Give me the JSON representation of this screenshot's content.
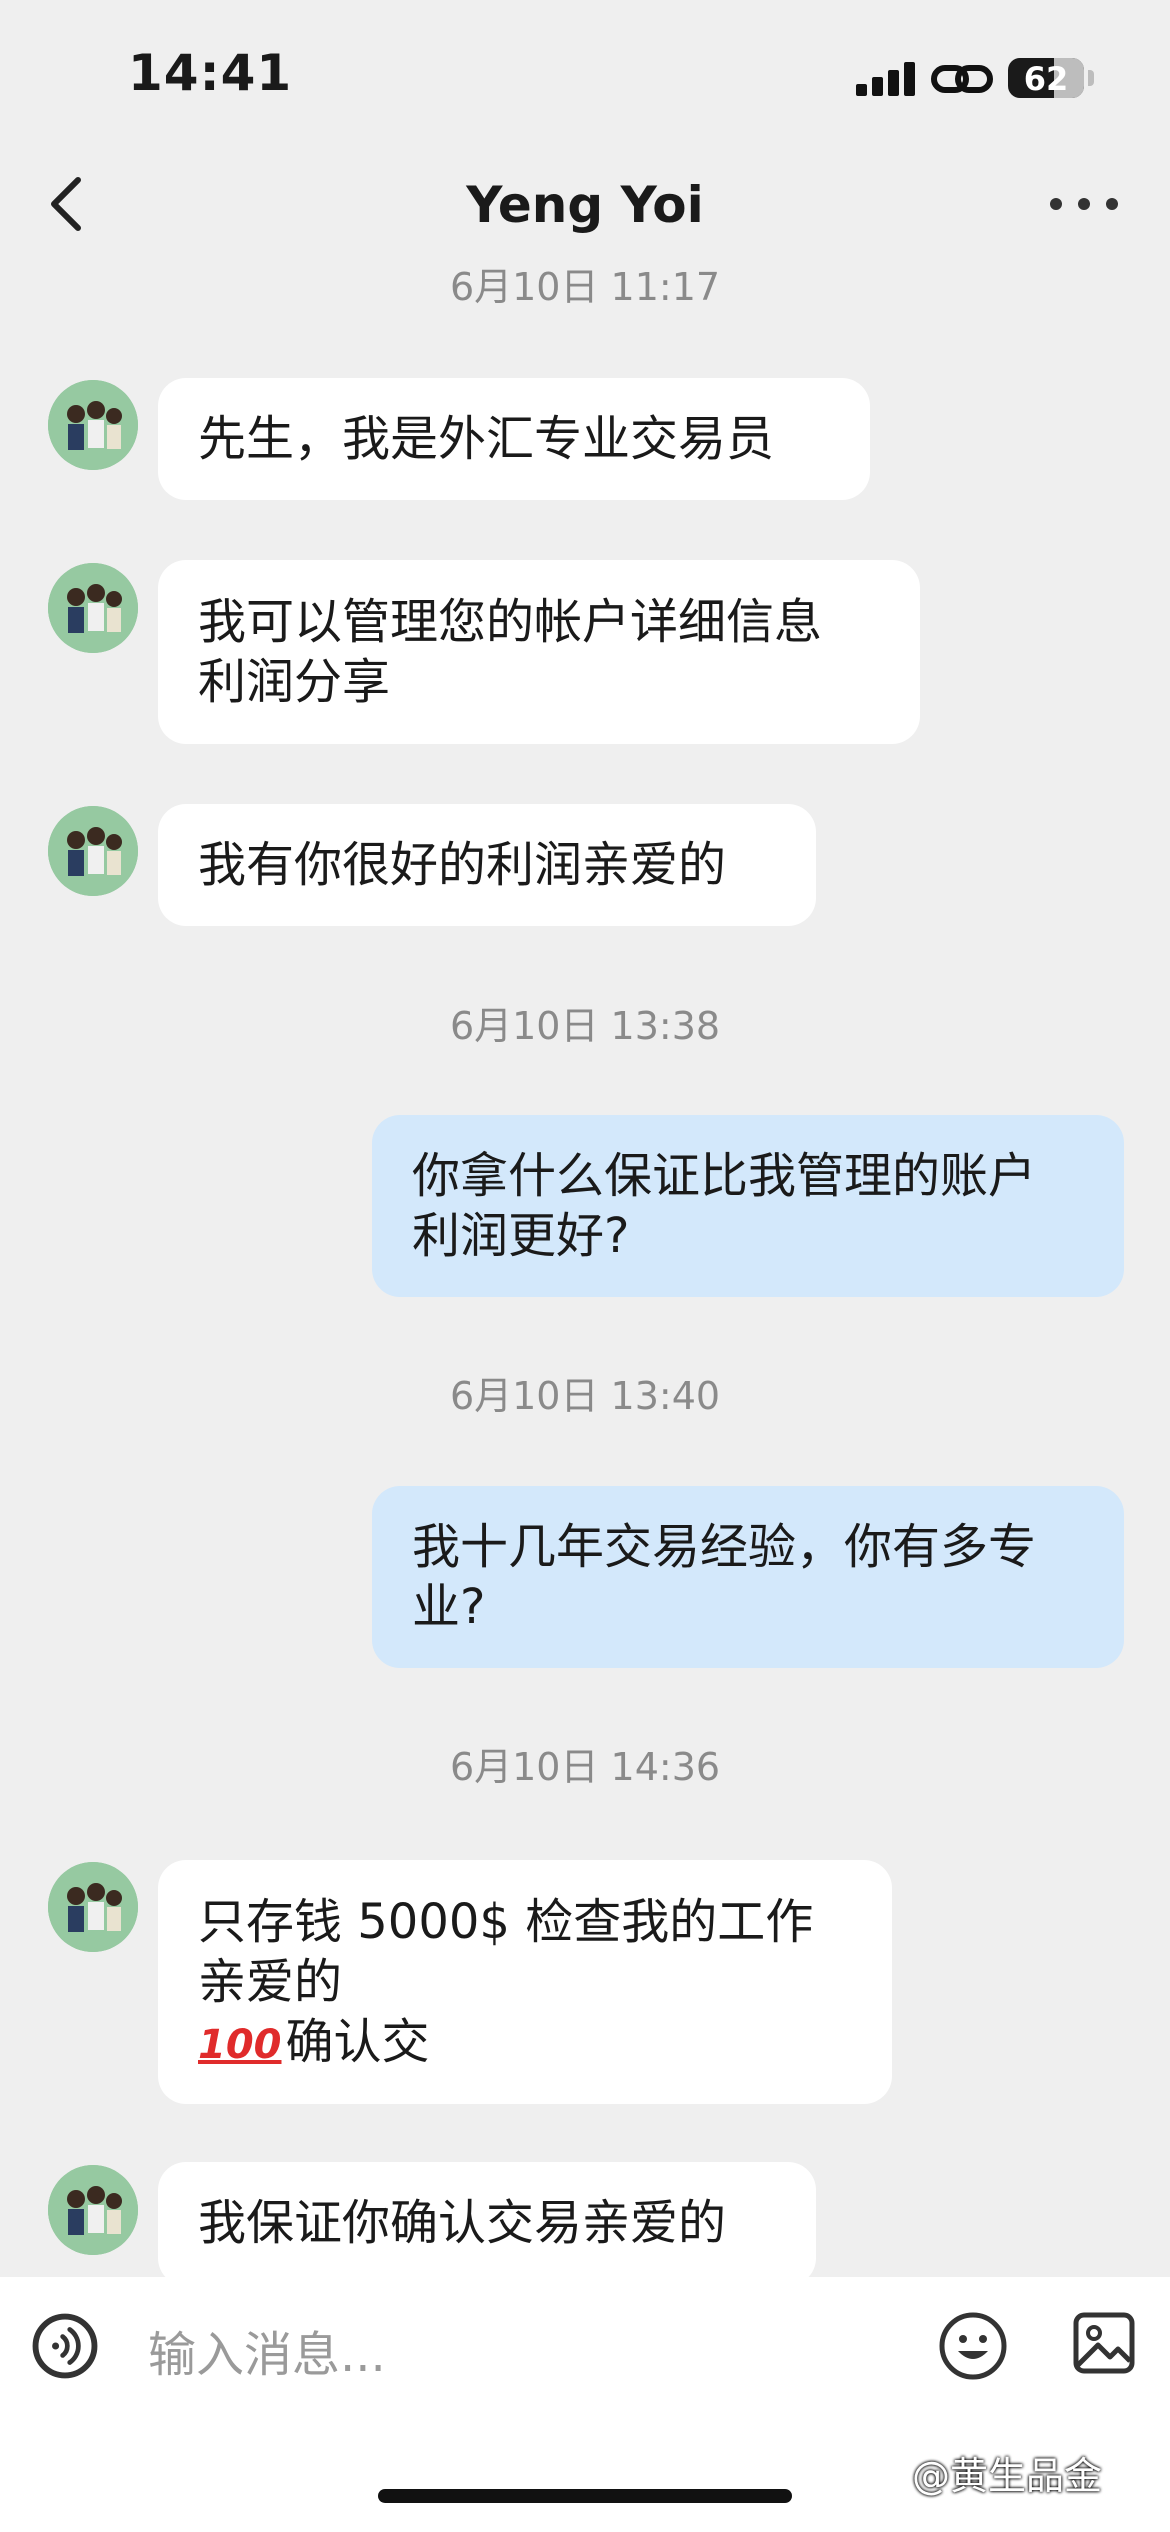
{
  "status_bar": {
    "time": "14:41",
    "battery": "62"
  },
  "header": {
    "title": "Yeng Yoi"
  },
  "messages": [
    {
      "type": "time",
      "text": "6月10日 11:17"
    },
    {
      "type": "in",
      "lines": [
        "先生，我是外汇专业交易员"
      ]
    },
    {
      "type": "in",
      "lines": [
        "我可以管理您的帐户详细信息",
        "利润分享"
      ]
    },
    {
      "type": "in",
      "lines": [
        "我有你很好的利润亲爱的"
      ]
    },
    {
      "type": "time",
      "text": "6月10日 13:38"
    },
    {
      "type": "out",
      "lines": [
        "你拿什么保证比我管理的账户",
        "利润更好?"
      ]
    },
    {
      "type": "time",
      "text": "6月10日 13:40"
    },
    {
      "type": "out",
      "lines": [
        "我十几年交易经验，你有多专",
        "业?"
      ]
    },
    {
      "type": "time",
      "text": "6月10日 14:36"
    },
    {
      "type": "in",
      "lines": [
        "只存钱 5000$ 检查我的工作",
        "亲爱的",
        "确认交"
      ],
      "emoji": "100"
    },
    {
      "type": "in",
      "lines": [
        "我保证你确认交易亲爱的"
      ]
    }
  ],
  "input": {
    "placeholder": "输入消息..."
  },
  "watermark": "@黄生品金",
  "icons": {
    "back": "chevron-left-icon",
    "more": "more-icon",
    "voice": "voice-icon",
    "emoji": "emoji-icon",
    "image": "image-icon"
  }
}
